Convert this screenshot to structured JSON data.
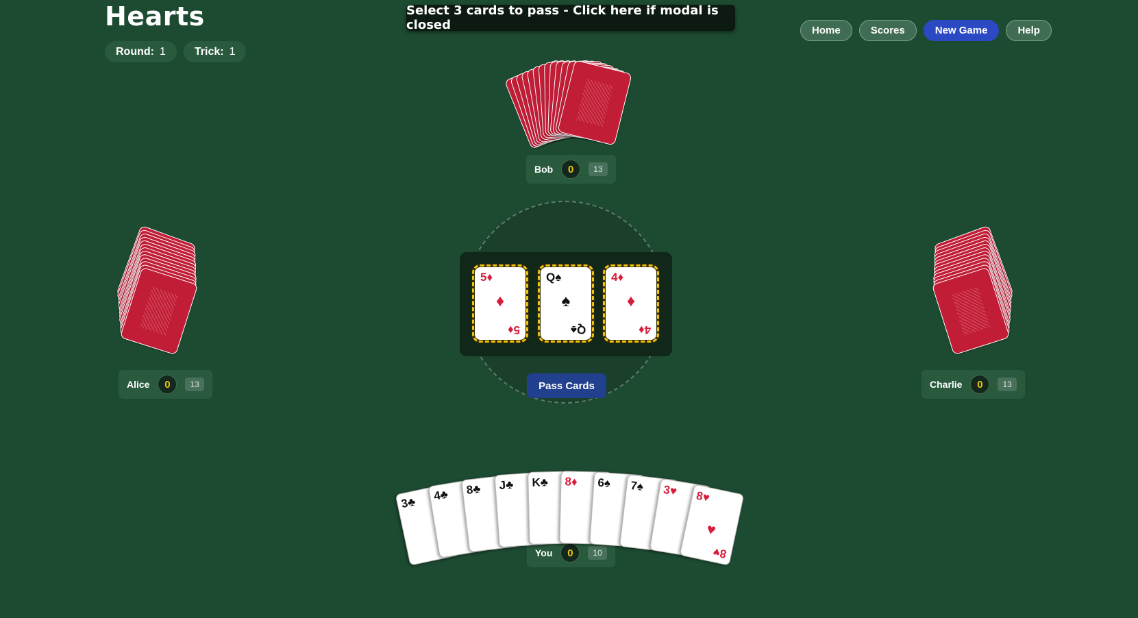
{
  "header": {
    "title": "Hearts",
    "round_label": "Round:",
    "round_value": "1",
    "trick_label": "Trick:",
    "trick_value": "1"
  },
  "banner": {
    "text": "Select 3 cards to pass - Click here if modal is closed"
  },
  "nav": {
    "home": "Home",
    "scores": "Scores",
    "new_game": "New Game",
    "help": "Help"
  },
  "players": {
    "bob": {
      "name": "Bob",
      "score": "0",
      "cards": "13"
    },
    "alice": {
      "name": "Alice",
      "score": "0",
      "cards": "13"
    },
    "charlie": {
      "name": "Charlie",
      "score": "0",
      "cards": "13"
    },
    "you": {
      "name": "You",
      "score": "0",
      "cards": "10"
    }
  },
  "selected_cards": [
    {
      "rank": "5",
      "suit": "♦",
      "color": "red"
    },
    {
      "rank": "Q",
      "suit": "♠",
      "color": "black"
    },
    {
      "rank": "4",
      "suit": "♦",
      "color": "red"
    }
  ],
  "pass_button": "Pass Cards",
  "hand": [
    {
      "rank": "3",
      "suit": "♣",
      "color": "black"
    },
    {
      "rank": "4",
      "suit": "♣",
      "color": "black"
    },
    {
      "rank": "8",
      "suit": "♣",
      "color": "black"
    },
    {
      "rank": "J",
      "suit": "♣",
      "color": "black"
    },
    {
      "rank": "K",
      "suit": "♣",
      "color": "black"
    },
    {
      "rank": "8",
      "suit": "♦",
      "color": "red"
    },
    {
      "rank": "6",
      "suit": "♠",
      "color": "black"
    },
    {
      "rank": "7",
      "suit": "♠",
      "color": "black"
    },
    {
      "rank": "3",
      "suit": "♥",
      "color": "red"
    },
    {
      "rank": "8",
      "suit": "♥",
      "color": "red"
    }
  ],
  "colors": {
    "felt": "#1d4b31",
    "card_back": "#c21d36",
    "accent": "#2a49c2",
    "score": "#f1c40f"
  }
}
